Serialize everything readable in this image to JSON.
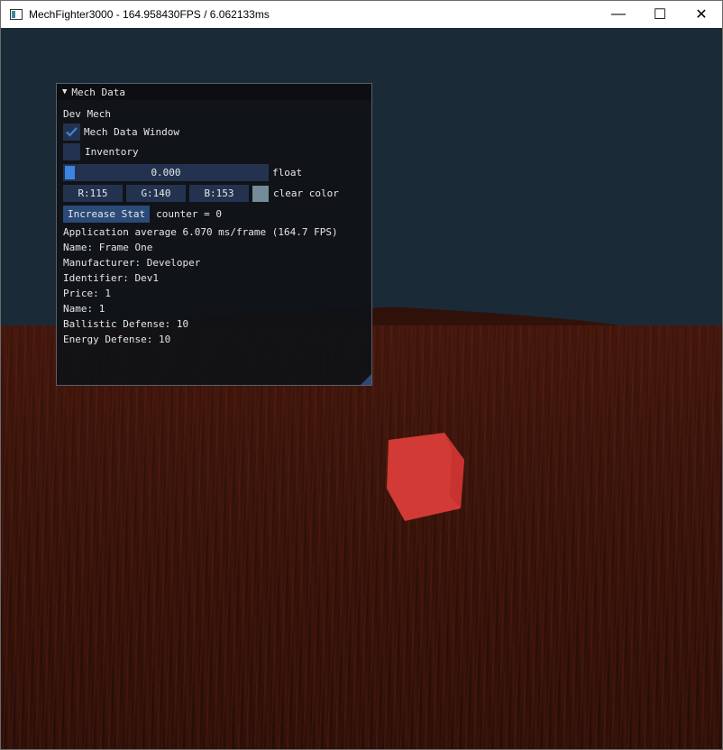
{
  "window": {
    "title": "MechFighter3000 - 164.958430FPS / 6.062133ms",
    "controls": {
      "minimize": "—",
      "maximize": "☐",
      "close": "✕"
    }
  },
  "scene": {
    "sky_color": "#1a2a37",
    "ground_color": "#2e1109",
    "cube_color": "#d13a35"
  },
  "panel": {
    "title": "Mech Data",
    "header_text": "Dev Mech",
    "checkbox_mech_data": {
      "label": "Mech Data Window",
      "checked": true
    },
    "checkbox_inventory": {
      "label": "Inventory",
      "checked": false
    },
    "float_slider": {
      "value_text": "0.000",
      "label": "float",
      "value": 0.0
    },
    "clear_color": {
      "r": "R:115",
      "g": "G:140",
      "b": "B:153",
      "label": "clear color",
      "swatch": "#738c99"
    },
    "increase_button": "Increase Stat",
    "counter_text": "counter = 0",
    "lines": [
      "Application average 6.070 ms/frame (164.7 FPS)",
      "Name: Frame One",
      "Manufacturer: Developer",
      "Identifier: Dev1",
      "Price: 1",
      "Name: 1",
      "Ballistic Defense: 10",
      "Energy Defense: 10"
    ]
  }
}
